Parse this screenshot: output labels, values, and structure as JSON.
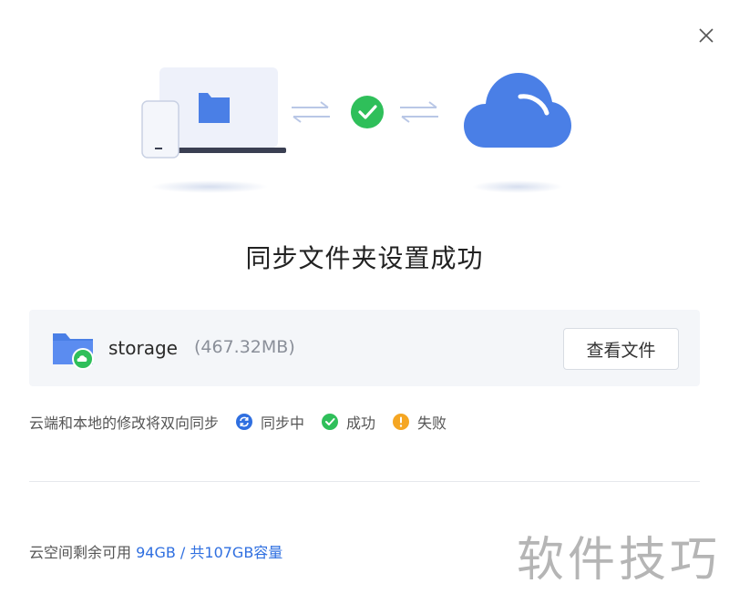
{
  "dialog": {
    "close_icon": "close-icon",
    "title": "同步文件夹设置成功"
  },
  "illustration": {
    "laptop_icon": "laptop-folder-icon",
    "sync_arrows_icon": "sync-arrows-icon",
    "success_icon": "check-circle-icon",
    "cloud_icon": "cloud-icon",
    "colors": {
      "cloud": "#4a7fe6",
      "success": "#2fbf5a",
      "folder": "#4a7fe6"
    }
  },
  "file": {
    "name": "storage",
    "size": "(467.32MB)",
    "icon": "folder-cloud-icon",
    "view_button": "查看文件"
  },
  "legend": {
    "note": "云端和本地的修改将双向同步",
    "items": [
      {
        "label": "同步中",
        "icon": "syncing-icon",
        "color": "#2f6fe0"
      },
      {
        "label": "成功",
        "icon": "success-icon",
        "color": "#2fbf5a"
      },
      {
        "label": "失败",
        "icon": "warning-icon",
        "color": "#f5a623"
      }
    ]
  },
  "storage": {
    "prefix": "云空间剩余可用 ",
    "free": "94GB",
    "sep": " / ",
    "total": "共107GB容量"
  },
  "watermark": "软件技巧"
}
